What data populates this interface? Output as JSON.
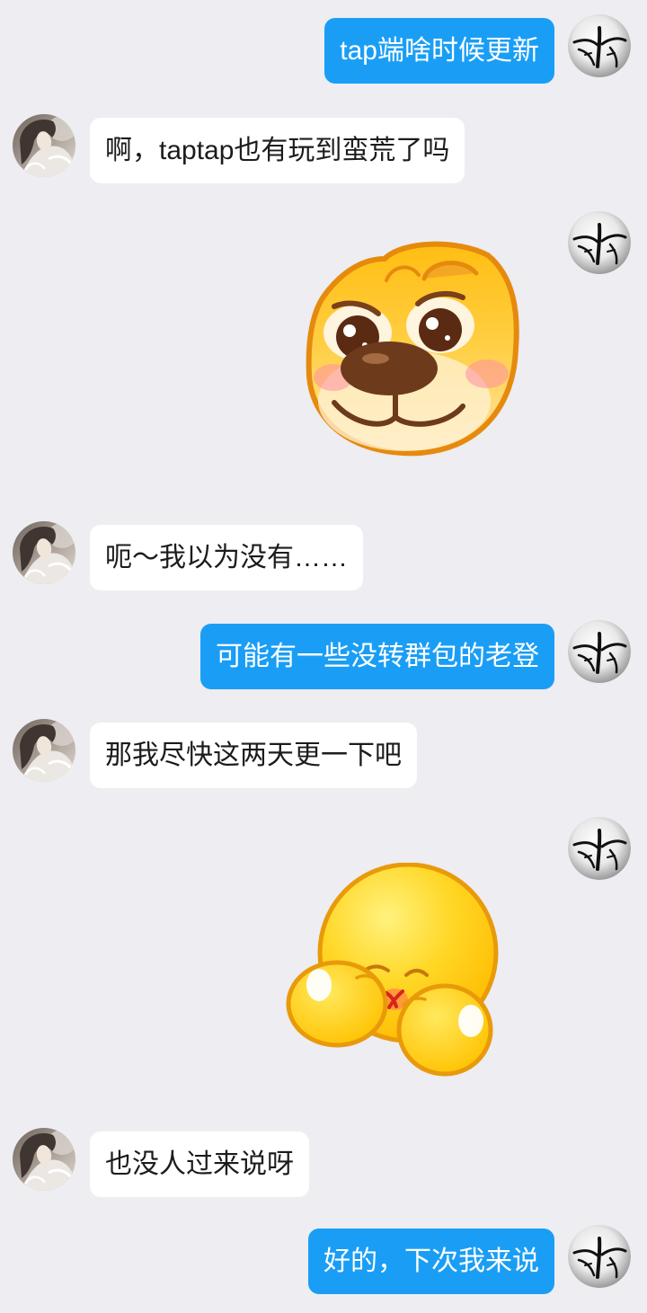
{
  "theme": {
    "background": "#ededf2",
    "self_bubble": "#1a9ef5",
    "self_text": "#ffffff",
    "other_bubble": "#ffffff",
    "other_text": "#1c1c1c"
  },
  "avatars": {
    "self_icon": "ink-brush-avatar",
    "contact_icon": "portrait-avatar"
  },
  "conversation": [
    {
      "outgoing": true,
      "text": "tap端啥时候更新"
    },
    {
      "outgoing": false,
      "text": "啊，taptap也有玩到蛮荒了吗"
    },
    {
      "outgoing": true,
      "sticker_icon": "dog-face-sticker"
    },
    {
      "outgoing": false,
      "text": "呃～我以为没有……"
    },
    {
      "outgoing": true,
      "text": "可能有一些没转群包的老登"
    },
    {
      "outgoing": false,
      "text": "那我尽快这两天更一下吧"
    },
    {
      "outgoing": true,
      "sticker_icon": "cover-mouth-emoji-sticker"
    },
    {
      "outgoing": false,
      "text": "也没人过来说呀"
    },
    {
      "outgoing": true,
      "text": "好的，下次我来说"
    }
  ]
}
